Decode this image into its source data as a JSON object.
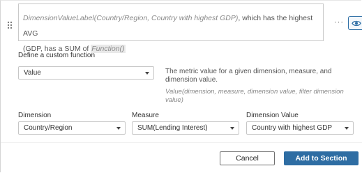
{
  "editor": {
    "func1": "DimensionValueLabel(Country/Region, Country with highest GDP)",
    "text1": ", which has the highest AVG",
    "text2": "(GDP, has a SUM of ",
    "func2": "Function()"
  },
  "icons": {
    "drag": "drag-handle-icon",
    "more": "more-options-icon",
    "visibility": "eye-icon"
  },
  "define": {
    "heading": "Define a custom function",
    "function_select": "Value",
    "description": "The metric value for a given dimension, measure, and dimension value.",
    "syntax": "Value(dimension, measure, dimension value, filter dimension value)"
  },
  "fields": {
    "dimension": {
      "label": "Dimension",
      "value": "Country/Region"
    },
    "measure": {
      "label": "Measure",
      "value": "SUM(Lending Interest)"
    },
    "dimension_value": {
      "label": "Dimension Value",
      "value": "Country with highest GDP"
    }
  },
  "actions": {
    "cancel": "Cancel",
    "add": "Add to Section"
  },
  "colors": {
    "accent": "#2e6da3",
    "border": "#c6c6c6",
    "muted": "#888888"
  }
}
